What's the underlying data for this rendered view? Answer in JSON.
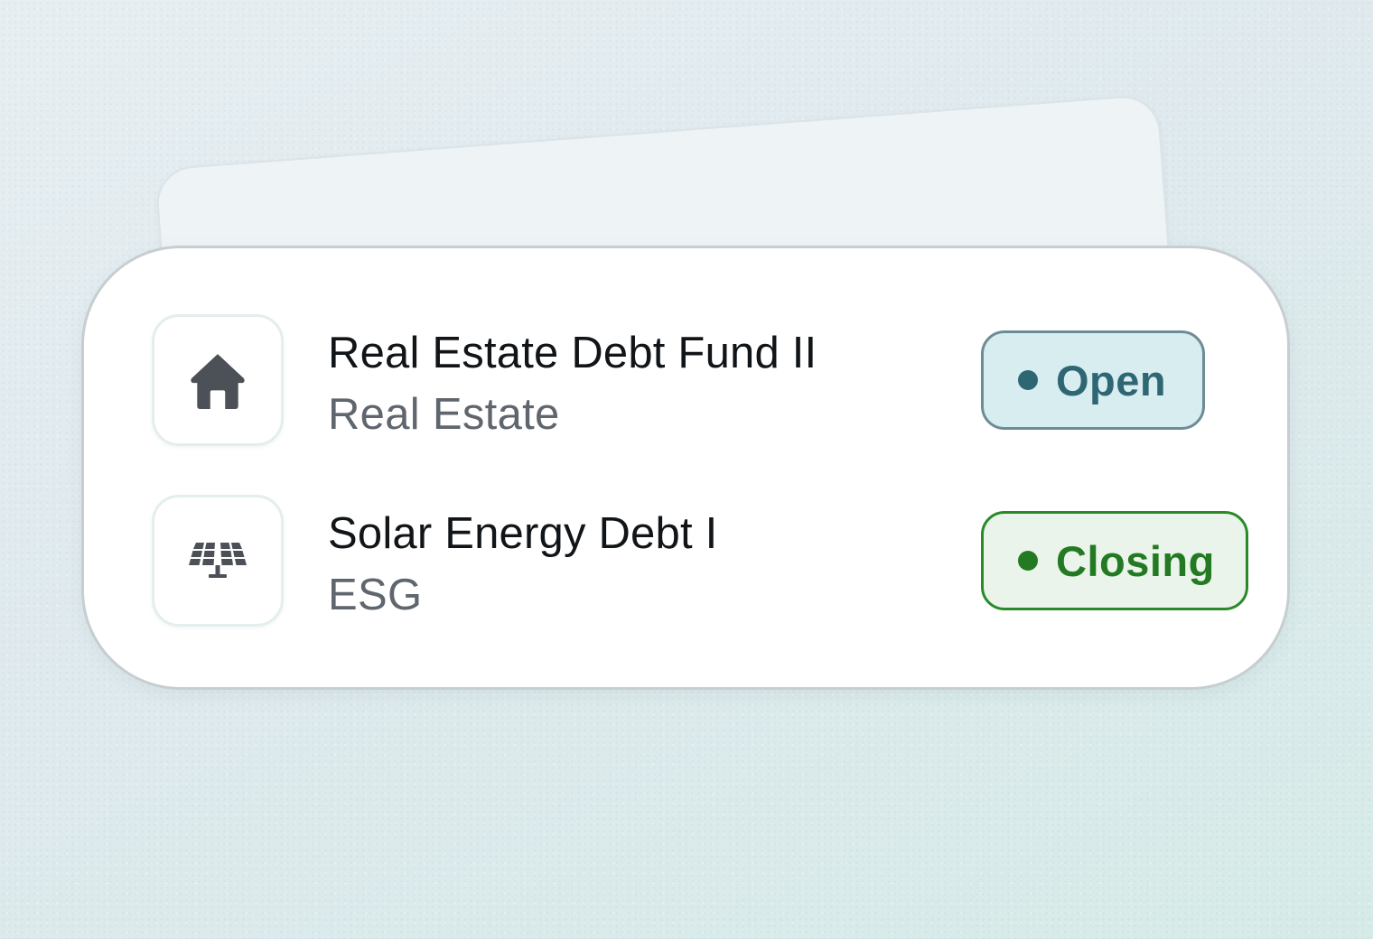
{
  "funds": [
    {
      "name": "Real Estate Debt Fund II",
      "category": "Real Estate",
      "icon": "home-icon",
      "status": "Open",
      "status_color": "#2f6674"
    },
    {
      "name": "Solar Energy Debt I",
      "category": "ESG",
      "icon": "solar-panel-icon",
      "status": "Closing",
      "status_color": "#237a23"
    }
  ]
}
